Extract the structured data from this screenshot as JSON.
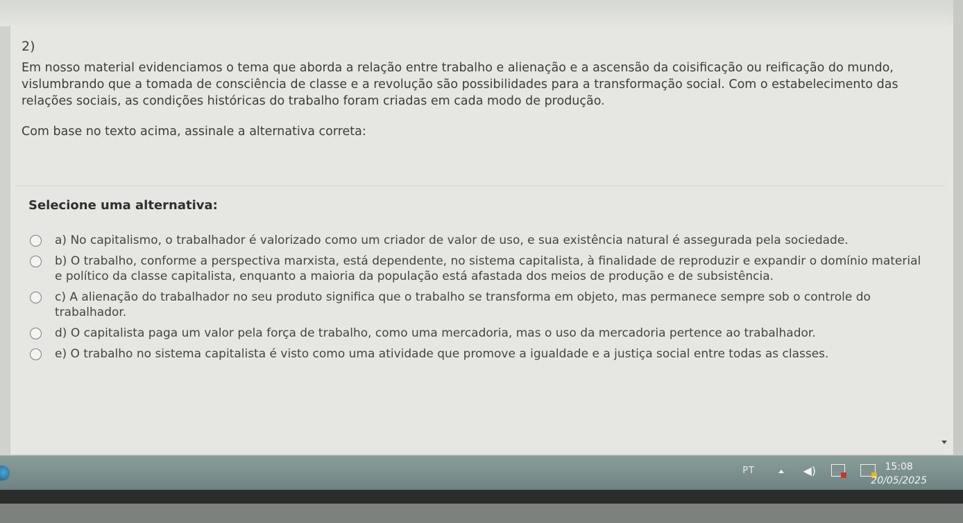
{
  "question": {
    "number": "2)",
    "statement": "Em nosso material evidenciamos o tema que aborda a relação entre trabalho e alienação e a ascensão da coisificação ou reificação do mundo, vislumbrando que a tomada de consciência de classe e a revolução são possibilidades para a transformação social. Com o estabelecimento das relações sociais, as condições históricas do trabalho foram criadas em cada modo de produção.",
    "command": "Com base no texto acima, assinale a alternativa correta:"
  },
  "select_title": "Selecione uma alternativa:",
  "options": [
    {
      "text": "a) No capitalismo, o trabalhador é valorizado como um criador de valor de uso, e sua existência natural é assegurada pela sociedade."
    },
    {
      "text": "b) O trabalho, conforme a perspectiva marxista, está dependente, no sistema capitalista, à finalidade de reproduzir e expandir o domínio material e político da classe capitalista, enquanto a maioria da população está afastada dos meios de produção e de subsistência."
    },
    {
      "text": "c) A alienação do trabalhador no seu produto significa que o trabalho se transforma em objeto, mas permanece sempre sob o controle do trabalhador."
    },
    {
      "text": "d) O capitalista paga um valor pela força de trabalho, como uma mercadoria, mas o uso da mercadoria pertence ao trabalhador."
    },
    {
      "text": "e) O trabalho no sistema capitalista é visto como uma atividade que promove a igualdade e a justiça social entre todas as classes."
    }
  ],
  "taskbar": {
    "language": "PT",
    "time": "15:08",
    "date": "20/05/2025"
  },
  "icons": {
    "scroll": "chevron-down-icon",
    "tray_expand": "chevron-up-icon",
    "volume": "speaker-icon",
    "action_center": "flag-icon",
    "network": "network-icon",
    "start": "start-orb-icon"
  }
}
